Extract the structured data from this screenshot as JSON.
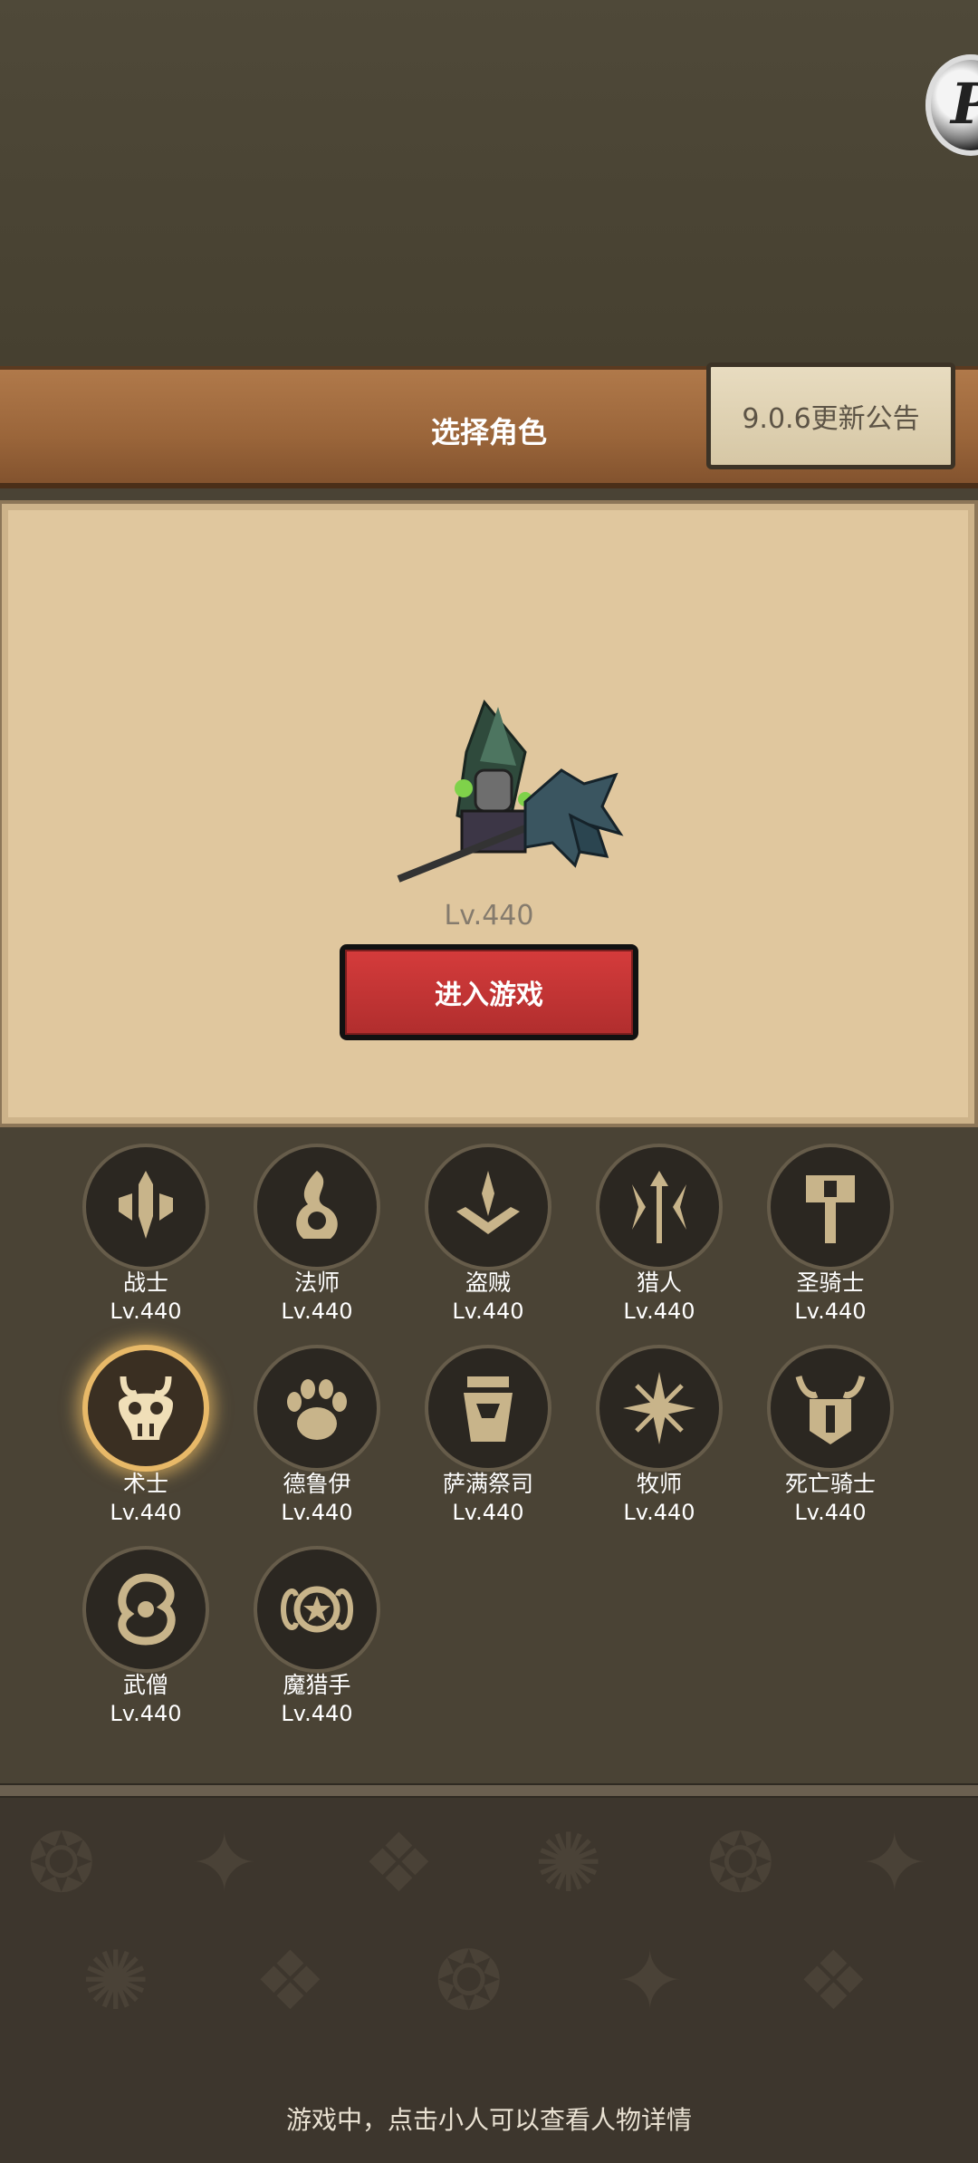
{
  "header": {
    "title": "选择角色",
    "notice_button": "9.0.6更新公告",
    "badge_letter": "P"
  },
  "hero": {
    "level": "Lv.440",
    "enter_button": "进入游戏"
  },
  "classes": [
    {
      "name": "战士",
      "level": "Lv.440",
      "icon": "sword-shield-icon"
    },
    {
      "name": "法师",
      "level": "Lv.440",
      "icon": "flame-icon"
    },
    {
      "name": "盗贼",
      "level": "Lv.440",
      "icon": "crossed-daggers-icon"
    },
    {
      "name": "猎人",
      "level": "Lv.440",
      "icon": "arrows-icon"
    },
    {
      "name": "圣骑士",
      "level": "Lv.440",
      "icon": "hammer-icon"
    },
    {
      "name": "术士",
      "level": "Lv.440",
      "icon": "demon-skull-icon",
      "selected": true
    },
    {
      "name": "德鲁伊",
      "level": "Lv.440",
      "icon": "paw-icon"
    },
    {
      "name": "萨满祭司",
      "level": "Lv.440",
      "icon": "totem-icon"
    },
    {
      "name": "牧师",
      "level": "Lv.440",
      "icon": "star-burst-icon"
    },
    {
      "name": "死亡骑士",
      "level": "Lv.440",
      "icon": "horned-helmet-icon"
    },
    {
      "name": "武僧",
      "level": "Lv.440",
      "icon": "swirl-icon"
    },
    {
      "name": "魔猎手",
      "level": "Lv.440",
      "icon": "demon-eye-icon"
    }
  ],
  "footer": {
    "hint": "游戏中，点击小人可以查看人物详情"
  },
  "colors": {
    "accent_gold": "#c8b48a",
    "selected_glow": "#e8b968",
    "enter_red": "#c83636"
  }
}
